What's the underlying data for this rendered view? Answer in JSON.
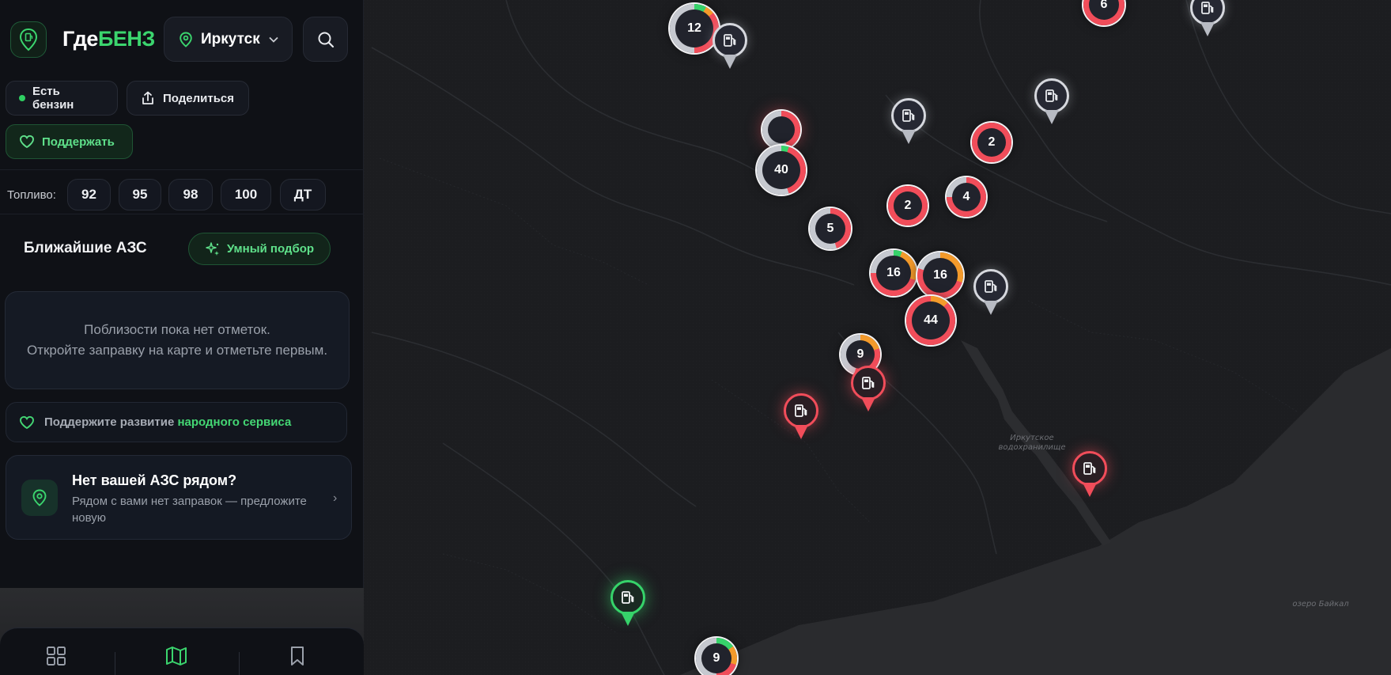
{
  "app": {
    "brand_white": "Где",
    "brand_green": "БЕНЗ"
  },
  "header": {
    "city": "Иркутск"
  },
  "actions": {
    "has_fuel": "Есть бензин",
    "share": "Поделиться",
    "support": "Поддержать"
  },
  "fuel": {
    "label": "Топливо:",
    "types": [
      "92",
      "95",
      "98",
      "100",
      "ДТ"
    ]
  },
  "nearby": {
    "title": "Ближайшие АЗС",
    "smart_pick": "Умный подбор",
    "empty_line1": "Поблизости пока нет отметок.",
    "empty_line2": "Откройте заправку на карте и отметьте первым."
  },
  "support_banner": {
    "text": "Поддержите развитие",
    "highlight": "народного сервиса"
  },
  "no_station": {
    "title": "Нет вашей АЗС рядом?",
    "subtitle": "Рядом с вами нет заправок — предложите новую",
    "chevron": "›"
  },
  "map": {
    "labels": {
      "reservoir": "Иркутское водохранилище",
      "lake": "озеро Байкал"
    },
    "clusters": [
      {
        "count": "12"
      },
      {
        "count": "6"
      },
      {
        "count": "2"
      },
      {
        "count": "40"
      },
      {
        "count": "4"
      },
      {
        "count": "2"
      },
      {
        "count": "5"
      },
      {
        "count": "16"
      },
      {
        "count": "16"
      },
      {
        "count": "44"
      },
      {
        "count": "9"
      },
      {
        "count": "9"
      }
    ]
  },
  "colors": {
    "accent_green": "#3bd56e",
    "status_red": "#f14d5a",
    "status_orange": "#f39a2b",
    "grey": "#c6c9d0"
  },
  "icons": [
    "fuel-pump-icon",
    "location-pin-icon",
    "chevron-down-icon",
    "search-icon",
    "share-icon",
    "heart-icon",
    "sparkle-icon",
    "grid-icon",
    "map-icon",
    "bookmark-icon"
  ]
}
